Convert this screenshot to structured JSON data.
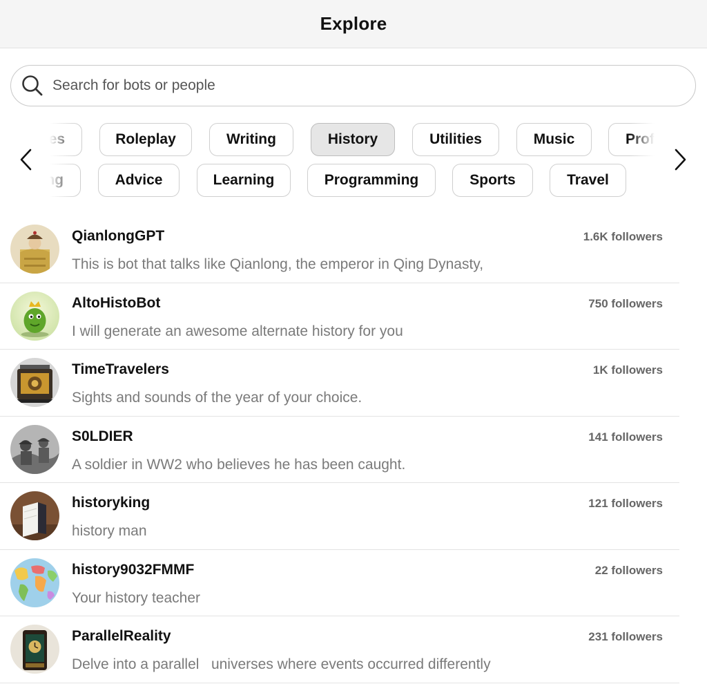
{
  "header": {
    "title": "Explore"
  },
  "search": {
    "placeholder": "Search for bots or people",
    "icon": "search-icon"
  },
  "categories": {
    "row1": [
      "Games",
      "Roleplay",
      "Writing",
      "History",
      "Utilities",
      "Music",
      "Professional"
    ],
    "row2": [
      "Gaming",
      "Advice",
      "Learning",
      "Programming",
      "Sports",
      "Travel"
    ],
    "active": "History"
  },
  "bots": [
    {
      "name": "QianlongGPT",
      "followers": "1.6K followers",
      "description": "This is bot that talks like Qianlong, the emperor in Qing Dynasty,"
    },
    {
      "name": "AltoHistoBot",
      "followers": "750 followers",
      "description": "I will generate an awesome alternate history for you"
    },
    {
      "name": "TimeTravelers",
      "followers": "1K followers",
      "description": "Sights and sounds of the year of your choice."
    },
    {
      "name": "S0LDIER",
      "followers": "141 followers",
      "description": "A soldier in WW2 who believes he has been caught."
    },
    {
      "name": "historyking",
      "followers": "121 followers",
      "description": "history man"
    },
    {
      "name": "history9032FMMF",
      "followers": "22 followers",
      "description": "Your history teacher"
    },
    {
      "name": "ParallelReality",
      "followers": "231 followers",
      "description": "Delve into a parallel   universes where events occurred differently"
    }
  ],
  "colors": {
    "active_chip": "#e6e6e6",
    "header_bg": "#f5f5f5",
    "muted_text": "#7a7a7a"
  }
}
